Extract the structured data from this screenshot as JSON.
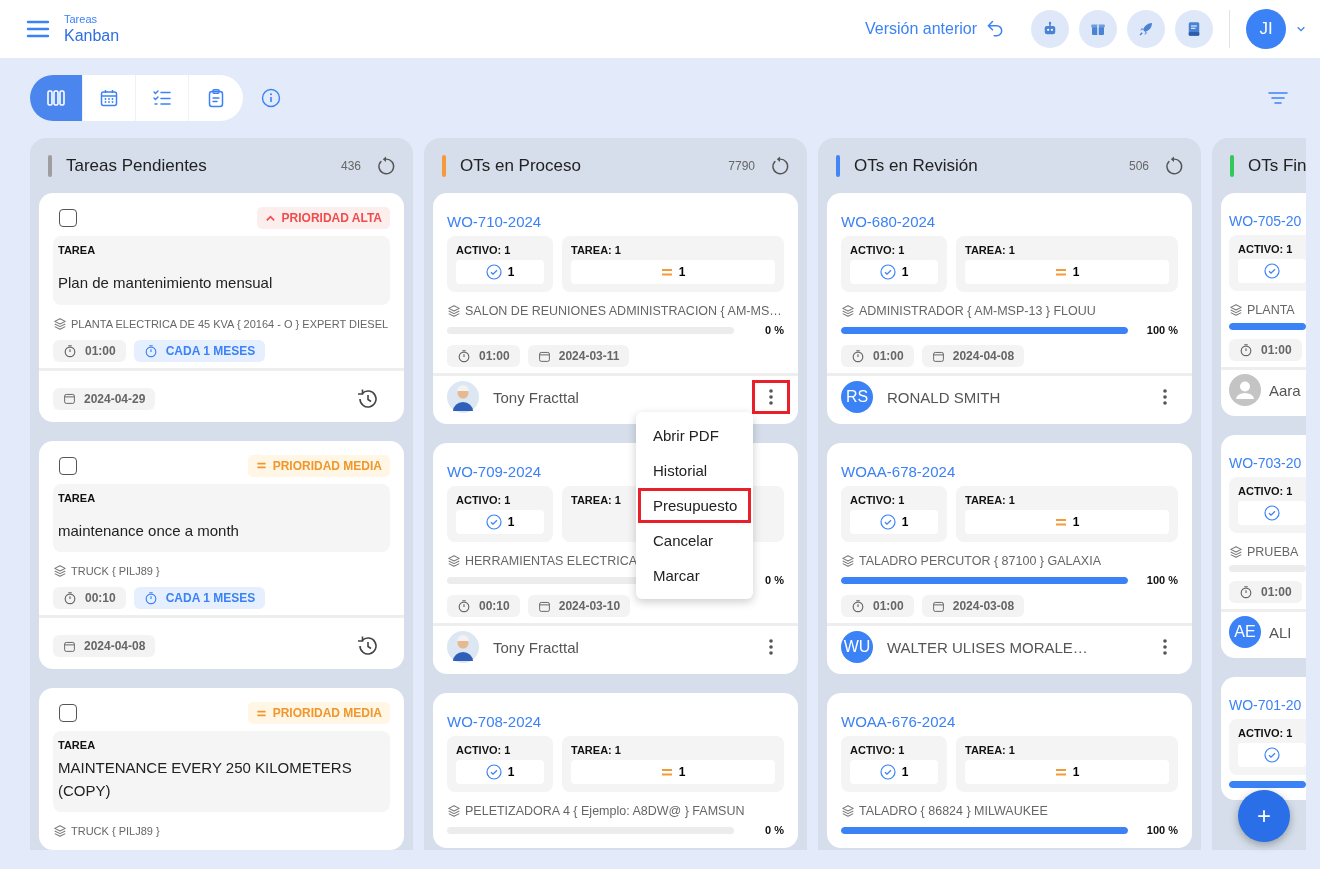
{
  "header": {
    "section": "Tareas",
    "title": "Kanban",
    "previous_version": "Versión anterior",
    "avatar_initials": "JI"
  },
  "view_tabs": [
    {
      "kind": "kanban",
      "selected": true
    },
    {
      "kind": "calendar",
      "selected": false
    },
    {
      "kind": "checklist",
      "selected": false
    },
    {
      "kind": "clipboard",
      "selected": false
    }
  ],
  "columns": [
    {
      "title": "Tareas Pendientes",
      "count": "436",
      "color": "#9e9e9e",
      "cards": [
        {
          "kind": "task",
          "checked": false,
          "priority": {
            "kind": "high",
            "label": "PRIORIDAD ALTA"
          },
          "section_label": "TAREA",
          "title": "Plan de mantenimiento mensual",
          "asset": "PLANTA ELECTRICA DE 45 KVA { 20164 - O } EXPERT DIESEL",
          "duration": "01:00",
          "frequency": "CADA 1 MESES",
          "date": "2024-04-29"
        },
        {
          "kind": "task",
          "checked": false,
          "priority": {
            "kind": "medium",
            "label": "PRIORIDAD MEDIA"
          },
          "section_label": "TAREA",
          "title": "maintenance once a month",
          "asset": "TRUCK { PILJ89 }",
          "duration": "00:10",
          "frequency": "CADA 1 MESES",
          "date": "2024-04-08"
        },
        {
          "kind": "task",
          "checked": false,
          "priority": {
            "kind": "medium",
            "label": "PRIORIDAD MEDIA"
          },
          "section_label": "TAREA",
          "title": "MAINTENANCE EVERY 250 KILOMETERS (COPY)",
          "asset": "TRUCK { PILJ89 }"
        }
      ]
    },
    {
      "title": "OTs en Proceso",
      "count": "7790",
      "color": "#f59a3b",
      "cards": [
        {
          "kind": "work_order",
          "code": "WO-710-2024",
          "asset_label": "ACTIVO: 1",
          "asset_count": "1",
          "task_label": "TAREA: 1",
          "task_count": "1",
          "asset": "SALON DE REUNIONES ADMINISTRACION { AM-MS…",
          "level": 0,
          "percent": "0 %",
          "duration": "01:00",
          "date": "2024-03-11",
          "assignee": {
            "kind": "photo",
            "name": "Tony Fracttal"
          },
          "menu_highlighted": true
        },
        {
          "kind": "work_order",
          "code": "WO-709-2024",
          "asset_label": "ACTIVO: 1",
          "asset_count": "1",
          "task_label": "TAREA: 1",
          "asset": "HERRAMIENTAS ELECTRICA",
          "level": 0,
          "percent": "0 %",
          "duration": "00:10",
          "date": "2024-03-10",
          "assignee": {
            "kind": "photo",
            "name": "Tony Fracttal"
          },
          "menu_highlighted": false
        },
        {
          "kind": "work_order",
          "code": "WO-708-2024",
          "asset_label": "ACTIVO: 1",
          "asset_count": "1",
          "task_label": "TAREA: 1",
          "task_count": "1",
          "asset": "PELETIZADORA 4 { Ejemplo: A8DW@ } FAMSUN",
          "level": 0,
          "percent": "0 %"
        }
      ]
    },
    {
      "title": "OTs en Revisión",
      "count": "506",
      "color": "#4285f4",
      "cards": [
        {
          "kind": "work_order",
          "code": "WO-680-2024",
          "asset_label": "ACTIVO: 1",
          "asset_count": "1",
          "task_label": "TAREA: 1",
          "task_count": "1",
          "asset": "ADMINISTRADOR { AM-MSP-13 } FLOUU",
          "level": 1,
          "percent": "100 %",
          "duration": "01:00",
          "date": "2024-04-08",
          "assignee": {
            "kind": "initials",
            "initials": "RS",
            "name": "RONALD SMITH"
          },
          "menu_highlighted": false
        },
        {
          "kind": "work_order",
          "code": "WOAA-678-2024",
          "asset_label": "ACTIVO: 1",
          "asset_count": "1",
          "task_label": "TAREA: 1",
          "task_count": "1",
          "asset": "TALADRO PERCUTOR { 87100 } GALAXIA",
          "level": 1,
          "percent": "100 %",
          "duration": "01:00",
          "date": "2024-03-08",
          "assignee": {
            "kind": "initials",
            "initials": "WU",
            "name": "WALTER ULISES MORALE…"
          },
          "menu_highlighted": false
        },
        {
          "kind": "work_order",
          "code": "WOAA-676-2024",
          "asset_label": "ACTIVO: 1",
          "asset_count": "1",
          "task_label": "TAREA: 1",
          "task_count": "1",
          "asset": "TALADRO { 86824 } MILWAUKEE",
          "level": 1,
          "percent": "100 %"
        }
      ]
    },
    {
      "title": "OTs Fin",
      "color": "#34c759",
      "cards": [
        {
          "kind": "work_order",
          "code": "WO-705-20",
          "asset_label": "ACTIVO: 1",
          "asset": "PLANTA",
          "level": 1,
          "duration": "01:00",
          "assignee": {
            "kind": "default",
            "name": "Aara"
          }
        },
        {
          "kind": "work_order",
          "code": "WO-703-20",
          "asset_label": "ACTIVO: 1",
          "asset": "PRUEBA",
          "level": 0,
          "duration": "01:00",
          "assignee": {
            "kind": "initials",
            "initials": "AE",
            "name": "ALI"
          }
        },
        {
          "kind": "work_order",
          "code": "WO-701-20",
          "asset_label": "ACTIVO: 1",
          "level": 1
        }
      ]
    }
  ],
  "context_menu": {
    "items": [
      {
        "label": "Abrir PDF",
        "highlighted": false
      },
      {
        "label": "Historial",
        "highlighted": false
      },
      {
        "label": "Presupuesto",
        "highlighted": true
      },
      {
        "label": "Cancelar",
        "highlighted": false
      },
      {
        "label": "Marcar",
        "highlighted": false
      }
    ]
  },
  "add_button": {
    "label": "+"
  }
}
